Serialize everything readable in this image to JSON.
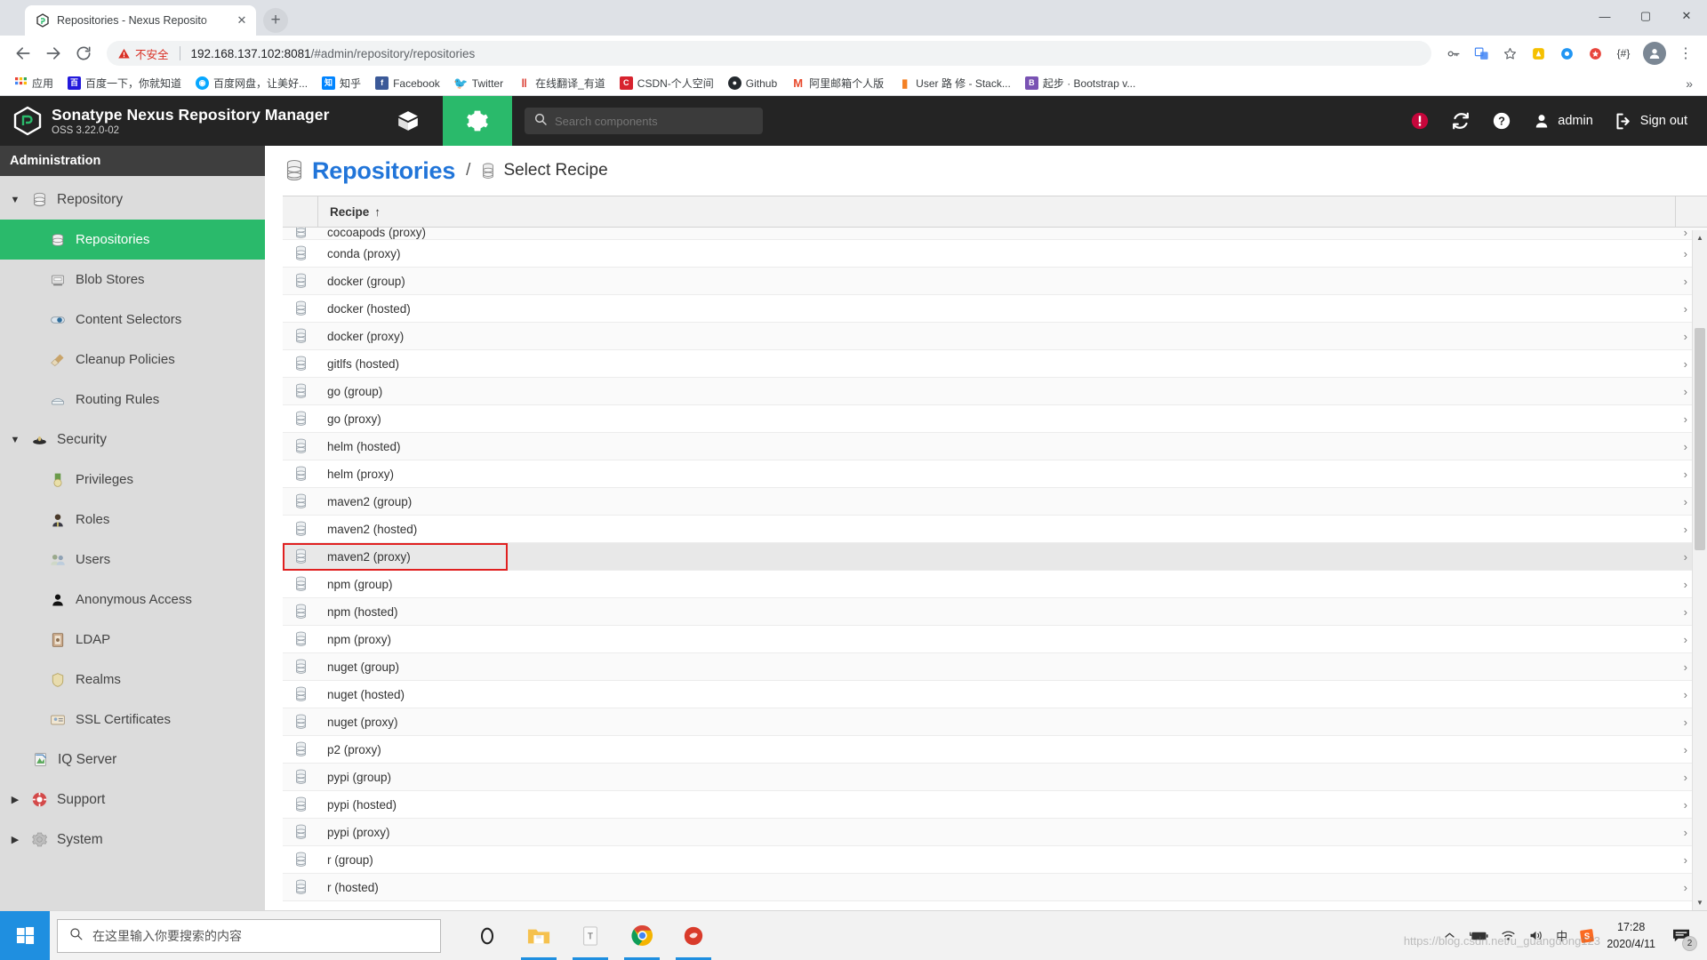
{
  "browser": {
    "tab": {
      "title": "Repositories - Nexus Reposito",
      "close_label": "✕",
      "favicon": "nexus-favicon"
    },
    "new_tab_label": "+",
    "window_controls": {
      "minimize": "—",
      "maximize": "▢",
      "close": "✕"
    },
    "nav": {
      "back": "←",
      "forward": "→",
      "reload": "⟳"
    },
    "omnibox": {
      "warning_icon": "warning-triangle-icon",
      "warning_text": "不安全",
      "url_host": "192.168.137.102:8081",
      "url_path": "/#admin/repository/repositories"
    },
    "toolbar_icons": [
      {
        "name": "password-key-icon",
        "glyph": "⚷"
      },
      {
        "name": "translate-icon",
        "glyph": "譯"
      },
      {
        "name": "bookmark-star-icon",
        "glyph": "☆"
      },
      {
        "name": "extension-colorful-icon",
        "glyph": "◈"
      },
      {
        "name": "extension-blue-icon",
        "glyph": "◉"
      },
      {
        "name": "extension-red-icon",
        "glyph": "✦"
      },
      {
        "name": "extension-code-icon",
        "glyph": "{#}"
      }
    ],
    "menu_label": "⋮",
    "bookmarks": [
      {
        "label": "应用",
        "icon": "apps-grid-icon",
        "color": "#ea4335"
      },
      {
        "label": "百度一下，你就知道",
        "icon": "baidu-icon",
        "color": "#2319dc"
      },
      {
        "label": "百度网盘，让美好...",
        "icon": "baidu-pan-icon",
        "color": "#06a7ff"
      },
      {
        "label": "知乎",
        "icon": "zhihu-icon",
        "color": "#0084ff"
      },
      {
        "label": "Facebook",
        "icon": "facebook-icon",
        "color": "#3b5998"
      },
      {
        "label": "Twitter",
        "icon": "twitter-icon",
        "color": "#1da1f2"
      },
      {
        "label": "在线翻译_有道",
        "icon": "youdao-icon",
        "color": "#d9372c"
      },
      {
        "label": "CSDN-个人空间",
        "icon": "csdn-icon",
        "color": "#d7232e"
      },
      {
        "label": "Github",
        "icon": "github-icon",
        "color": "#24292e"
      },
      {
        "label": "阿里邮箱个人版",
        "icon": "alimail-icon",
        "color": "#e8492b"
      },
      {
        "label": "User 路 修 - Stack...",
        "icon": "stackoverflow-icon",
        "color": "#f48024"
      },
      {
        "label": "起步 · Bootstrap v...",
        "icon": "bootstrap-icon",
        "color": "#7952b3"
      }
    ],
    "bookmarks_overflow": "»"
  },
  "nexus": {
    "logo_name": "nexus-logo-icon",
    "product_title": "Sonatype Nexus Repository Manager",
    "product_version": "OSS 3.22.0-02",
    "modes": [
      {
        "name": "browse-mode",
        "icon": "cube-icon",
        "active": false
      },
      {
        "name": "admin-mode",
        "icon": "gear-icon",
        "active": true
      }
    ],
    "search_placeholder": "Search components",
    "search_value": "",
    "accent_color": "#2aba6b",
    "header_right": [
      {
        "name": "alert-icon",
        "label": ""
      },
      {
        "name": "refresh-icon",
        "label": ""
      },
      {
        "name": "help-icon",
        "label": ""
      },
      {
        "name": "user-icon",
        "label": "admin"
      },
      {
        "name": "sign-out-icon",
        "label": "Sign out"
      }
    ],
    "sidebar": {
      "heading": "Administration",
      "items": [
        {
          "label": "Repository",
          "icon": "repository-icon",
          "type": "group",
          "expanded": true,
          "caret": "▼"
        },
        {
          "label": "Repositories",
          "icon": "repositories-icon",
          "type": "item",
          "selected": true
        },
        {
          "label": "Blob Stores",
          "icon": "blob-stores-icon",
          "type": "item",
          "selected": false
        },
        {
          "label": "Content Selectors",
          "icon": "content-selectors-icon",
          "type": "item",
          "selected": false
        },
        {
          "label": "Cleanup Policies",
          "icon": "cleanup-policies-icon",
          "type": "item",
          "selected": false
        },
        {
          "label": "Routing Rules",
          "icon": "routing-rules-icon",
          "type": "item",
          "selected": false
        },
        {
          "label": "Security",
          "icon": "security-icon",
          "type": "group",
          "expanded": true,
          "caret": "▼"
        },
        {
          "label": "Privileges",
          "icon": "privileges-icon",
          "type": "item",
          "selected": false
        },
        {
          "label": "Roles",
          "icon": "roles-icon",
          "type": "item",
          "selected": false
        },
        {
          "label": "Users",
          "icon": "users-icon",
          "type": "item",
          "selected": false
        },
        {
          "label": "Anonymous Access",
          "icon": "anonymous-access-icon",
          "type": "item",
          "selected": false
        },
        {
          "label": "LDAP",
          "icon": "ldap-icon",
          "type": "item",
          "selected": false
        },
        {
          "label": "Realms",
          "icon": "realms-icon",
          "type": "item",
          "selected": false
        },
        {
          "label": "SSL Certificates",
          "icon": "ssl-certificates-icon",
          "type": "item",
          "selected": false
        },
        {
          "label": "IQ Server",
          "icon": "iq-server-icon",
          "type": "subgroup",
          "selected": false
        },
        {
          "label": "Support",
          "icon": "support-icon",
          "type": "group",
          "expanded": false,
          "caret": "▶"
        },
        {
          "label": "System",
          "icon": "system-icon",
          "type": "group",
          "expanded": false,
          "caret": "▶"
        }
      ]
    },
    "breadcrumb": {
      "root": "Repositories",
      "separator": "/",
      "current": "Select Recipe"
    },
    "table": {
      "column_header": "Recipe",
      "sort_indicator": "↑",
      "row_chevron": "›",
      "rows": [
        {
          "label": "cocoapods (proxy)",
          "partial": true
        },
        {
          "label": "conda (proxy)"
        },
        {
          "label": "docker (group)"
        },
        {
          "label": "docker (hosted)"
        },
        {
          "label": "docker (proxy)"
        },
        {
          "label": "gitlfs (hosted)"
        },
        {
          "label": "go (group)"
        },
        {
          "label": "go (proxy)"
        },
        {
          "label": "helm (hosted)"
        },
        {
          "label": "helm (proxy)"
        },
        {
          "label": "maven2 (group)"
        },
        {
          "label": "maven2 (hosted)"
        },
        {
          "label": "maven2 (proxy)",
          "highlighted": true
        },
        {
          "label": "npm (group)"
        },
        {
          "label": "npm (hosted)"
        },
        {
          "label": "npm (proxy)"
        },
        {
          "label": "nuget (group)"
        },
        {
          "label": "nuget (hosted)"
        },
        {
          "label": "nuget (proxy)"
        },
        {
          "label": "p2 (proxy)"
        },
        {
          "label": "pypi (group)"
        },
        {
          "label": "pypi (hosted)"
        },
        {
          "label": "pypi (proxy)"
        },
        {
          "label": "r (group)"
        },
        {
          "label": "r (hosted)",
          "partial": true
        }
      ]
    }
  },
  "taskbar": {
    "start_name": "windows-start-icon",
    "search_placeholder": "在这里输入你要搜索的内容",
    "apps": [
      {
        "name": "cortana-icon",
        "running": false
      },
      {
        "name": "file-explorer-icon",
        "running": true
      },
      {
        "name": "text-editor-icon",
        "running": true
      },
      {
        "name": "chrome-icon",
        "running": true
      },
      {
        "name": "rhino-icon",
        "running": true
      }
    ],
    "tray": [
      {
        "name": "show-hidden-icons-icon",
        "glyph": "^"
      },
      {
        "name": "battery-icon",
        "glyph": ""
      },
      {
        "name": "wifi-icon",
        "glyph": ""
      },
      {
        "name": "volume-icon",
        "glyph": ""
      },
      {
        "name": "ime-icon",
        "glyph": "中"
      },
      {
        "name": "sogou-icon",
        "glyph": "S"
      }
    ],
    "clock_time": "17:28",
    "clock_date": "2020/4/11",
    "notification_count": "2",
    "watermark": "https://blog.csdn.net/u_guangdong123"
  }
}
